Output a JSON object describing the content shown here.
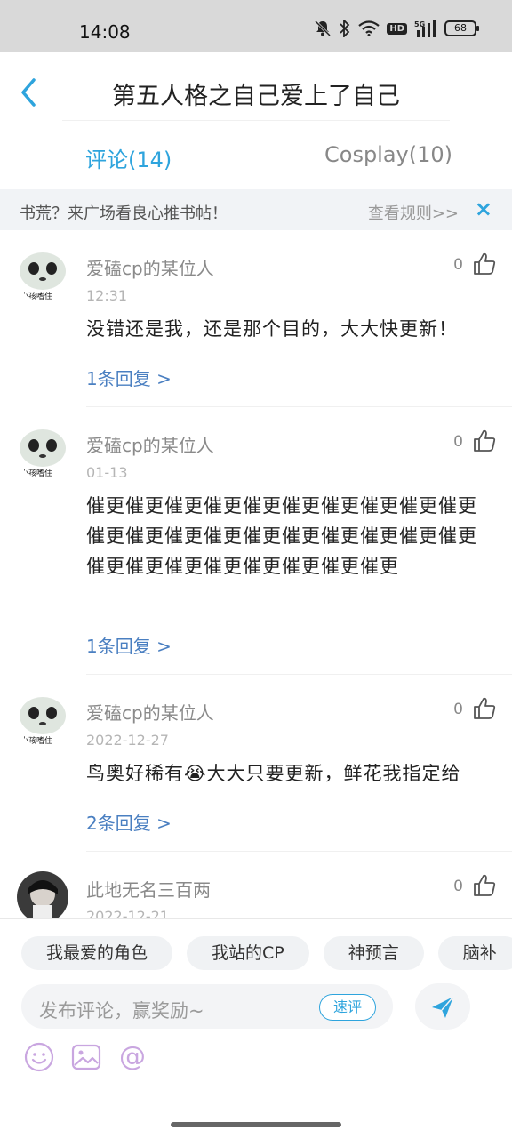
{
  "status_bar": {
    "time": "14:08",
    "battery": "68",
    "network": "5G",
    "hd": "HD"
  },
  "header": {
    "title": "第五人格之自己爱上了自己"
  },
  "tabs": [
    {
      "label": "评论(14)",
      "active": true
    },
    {
      "label": "Cosplay(10)",
      "active": false
    }
  ],
  "banner": {
    "text": "书荒？来广场看良心推书帖！",
    "link": "查看规则>>",
    "close": "×"
  },
  "comments": [
    {
      "user": "爱磕cp的某位人",
      "time": "12:31",
      "text": "没错还是我，还是那个目的，大大快更新！",
      "replies": "1条回复 >",
      "likes": "0",
      "avatar_caption": "小孩嗜住"
    },
    {
      "user": "爱磕cp的某位人",
      "time": "01-13",
      "text": "催更催更催更催更催更催更催更催更催更催更催更催更催更催更催更催更催更催更催更催更催更催更催更催更催更催更催更催更",
      "replies": "1条回复 >",
      "likes": "0",
      "avatar_caption": "小孩嗜住"
    },
    {
      "user": "爱磕cp的某位人",
      "time": "2022-12-27",
      "text": "鸟奥好稀有😭大大只要更新，鲜花我指定给",
      "replies": "2条回复 >",
      "likes": "0",
      "avatar_caption": "小孩嗜住"
    },
    {
      "user": "此地无名三百两",
      "time": "2022-12-21",
      "likes": "0"
    }
  ],
  "bottom": {
    "chips": [
      "我最爱的角色",
      "我站的CP",
      "神预言",
      "脑补"
    ],
    "input_placeholder": "发布评论，赢奖励~",
    "quick_label": "速评"
  },
  "colors": {
    "accent": "#2ea4dd",
    "reply": "#4a7fc1",
    "emoji_icons": "#c9a6e0"
  }
}
